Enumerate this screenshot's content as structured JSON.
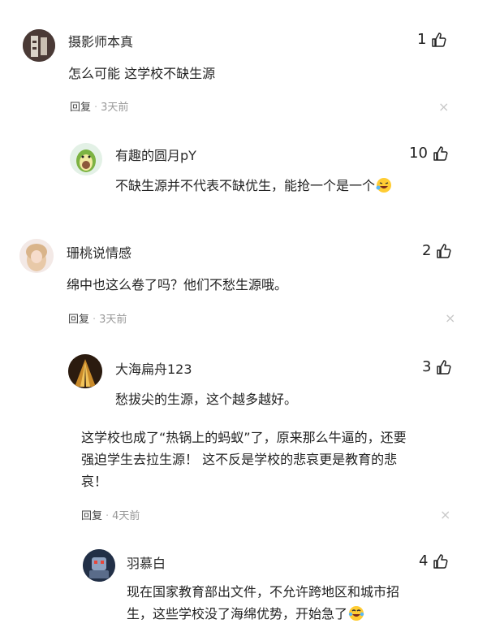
{
  "comments": [
    {
      "user": "摄影师本真",
      "likes": "1",
      "text": "怎么可能 这学校不缺生源",
      "reply_label": "回复",
      "time": "3天前",
      "replies": [
        {
          "user": "有趣的圆月pY",
          "likes": "10",
          "text": "不缺生源并不代表不缺优生，能抢一个是一个"
        }
      ]
    },
    {
      "user": "珊桃说情感",
      "likes": "2",
      "text": "绵中也这么卷了吗？他们不愁生源哦。",
      "reply_label": "回复",
      "time": "3天前",
      "replies": [
        {
          "user": "大海扁舟123",
          "likes": "3",
          "text": "愁拔尖的生源，这个越多越好。"
        }
      ]
    },
    {
      "text_line1": "这学校也成了“热锅上的蚂蚁”了，原来那么牛逼的，还要",
      "text_line2": "强迫学生去拉生源！ 这不反是学校的悲哀更是教育的悲",
      "text_line3": "哀！",
      "reply_label": "回复",
      "time": "4天前",
      "replies": [
        {
          "user": "羽慕白",
          "likes": "4",
          "text_line1": "现在国家教育部出文件，不允许跨地区和城市招",
          "text_line2": "生，这些学校没了海绵优势，开始急了"
        }
      ]
    }
  ],
  "colors": {
    "text": "#222222",
    "meta": "#999999",
    "close": "#c8c8c8"
  },
  "icons": {
    "like": "thumbs-up-icon",
    "close": "close-icon"
  }
}
